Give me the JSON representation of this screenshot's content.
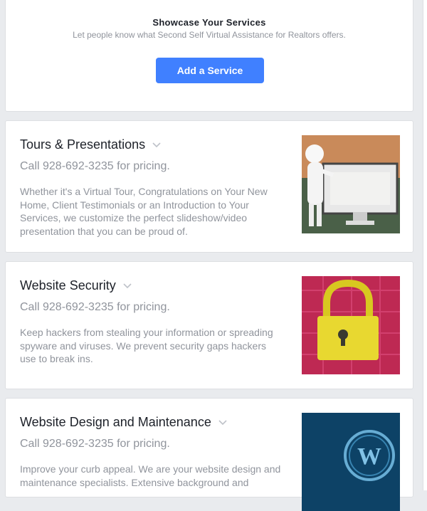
{
  "showcase": {
    "title": "Showcase Your Services",
    "subtitle": "Let people know what Second Self Virtual Assistance for Realtors offers.",
    "button_label": "Add a Service"
  },
  "services": [
    {
      "title": "Tours & Presentations",
      "price": "Call 928-692-3235 for pricing.",
      "description": "Whether it's a Virtual Tour, Congratulations on Your New Home, Client Testimonials or an Introduction to Your Services, we customize the perfect slideshow/video presentation that you can be proud of.",
      "image_alt": "home-is-where-the-heart-is-sign-on-monitor"
    },
    {
      "title": "Website Security",
      "price": "Call 928-692-3235 for pricing.",
      "description": "Keep hackers from stealing your information or spreading spyware and viruses. We prevent security gaps hackers use to break ins.",
      "image_alt": "padlock-on-circuit-board"
    },
    {
      "title": "Website Design and Maintenance",
      "price": "Call 928-692-3235 for pricing.",
      "description": "Improve your curb appeal. We are your website design and maintenance specialists. Extensive background and",
      "image_alt": "wordpress-logo-blue"
    }
  ],
  "colors": {
    "accent": "#4080ff",
    "page_bg": "#e9ebee",
    "muted_text": "#90949c"
  }
}
